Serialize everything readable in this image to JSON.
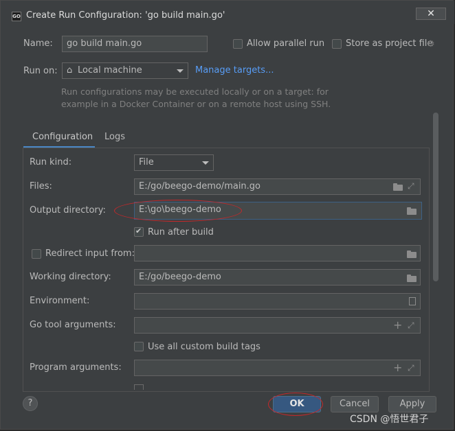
{
  "window": {
    "title": "Create Run Configuration: 'go build main.go'",
    "icon": "GO",
    "close_label": "✕"
  },
  "name": {
    "label": "Name:",
    "value": "go build main.go"
  },
  "allow_parallel": {
    "label": "Allow parallel run",
    "checked": false
  },
  "store_project": {
    "label": "Store as project file",
    "checked": false
  },
  "run_on": {
    "label": "Run on:",
    "value": "Local machine",
    "manage_link": "Manage targets...",
    "hint_line1": "Run configurations may be executed locally or on a target: for",
    "hint_line2": "example in a Docker Container or on a remote host using SSH."
  },
  "tabs": [
    {
      "label": "Configuration",
      "active": true
    },
    {
      "label": "Logs",
      "active": false
    }
  ],
  "form": {
    "run_kind": {
      "label": "Run kind:",
      "value": "File"
    },
    "files": {
      "label": "Files:",
      "value": "E:/go/beego-demo/main.go"
    },
    "output_dir": {
      "label": "Output directory:",
      "value": "E:\\go\\beego-demo"
    },
    "run_after_build": {
      "label": "Run after build",
      "checked": true
    },
    "redirect_input": {
      "label": "Redirect input from:",
      "checked": false,
      "value": ""
    },
    "working_dir": {
      "label": "Working directory:",
      "value": "E:/go/beego-demo"
    },
    "environment": {
      "label": "Environment:",
      "value": ""
    },
    "go_tool_args": {
      "label": "Go tool arguments:",
      "value": ""
    },
    "custom_build_tags": {
      "label": "Use all custom build tags",
      "checked": false
    },
    "program_args": {
      "label": "Program arguments:",
      "value": ""
    }
  },
  "buttons": {
    "help": "?",
    "ok": "OK",
    "cancel": "Cancel",
    "apply": "Apply"
  },
  "watermark": "CSDN @悟世君子",
  "colors": {
    "accent": "#589df6",
    "primary_button": "#365880",
    "annotation": "#c6282a"
  }
}
